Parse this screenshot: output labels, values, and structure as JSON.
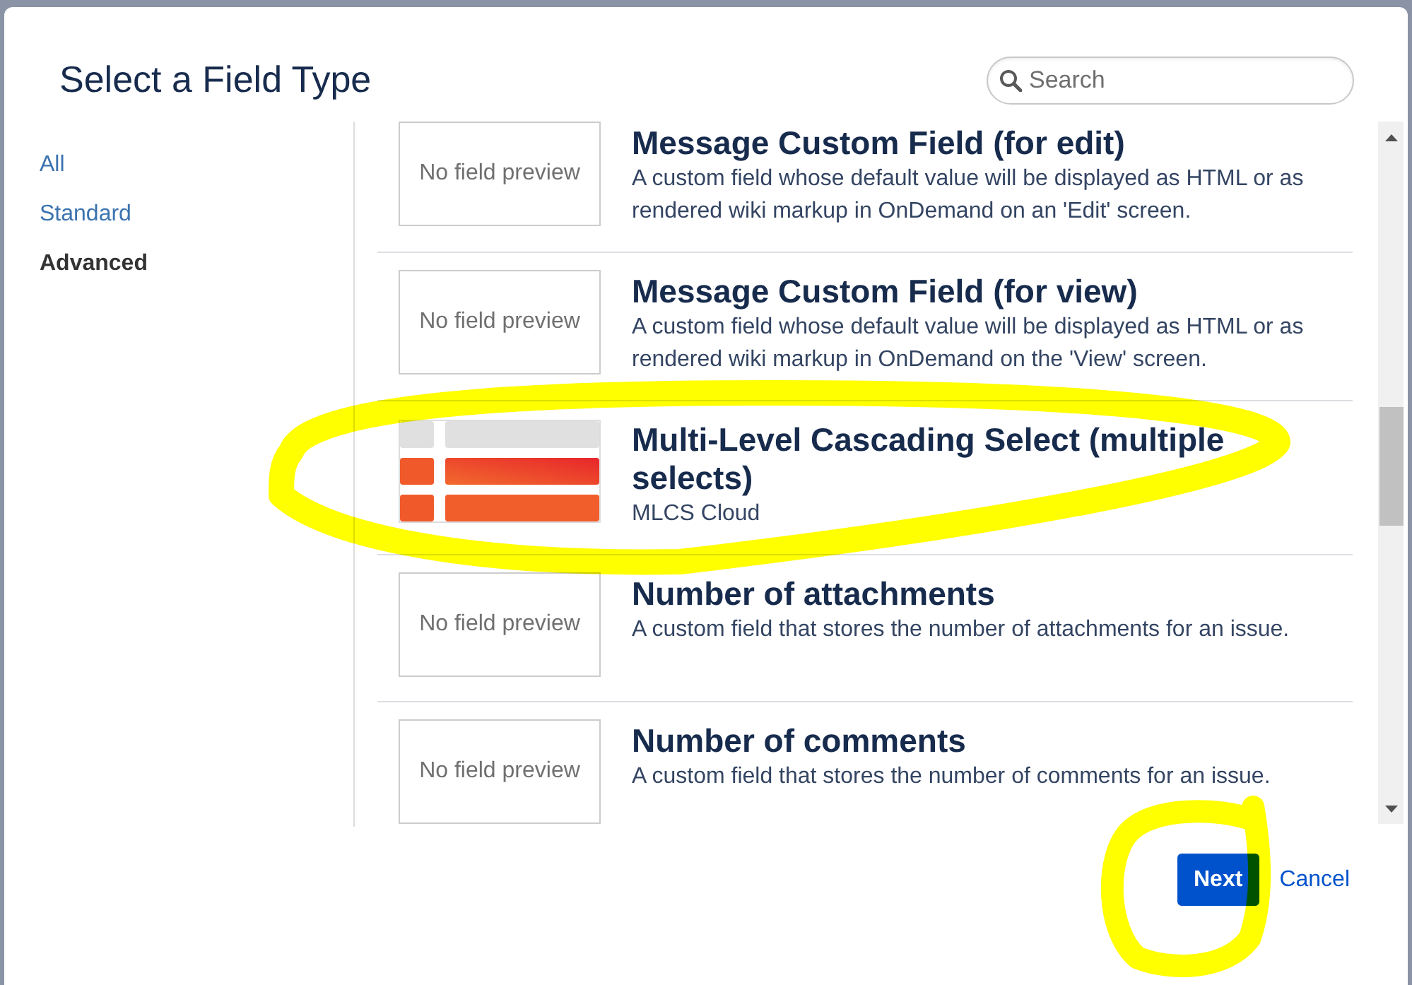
{
  "dialog": {
    "title": "Select a Field Type"
  },
  "search": {
    "placeholder": "Search"
  },
  "sidebar": {
    "items": [
      {
        "label": "All",
        "selected": false
      },
      {
        "label": "Standard",
        "selected": false
      },
      {
        "label": "Advanced",
        "selected": true
      }
    ]
  },
  "fields": [
    {
      "title": "Message Custom Field (for edit)",
      "description": "A custom field whose default value will be displayed as HTML or as rendered wiki markup in OnDemand on an 'Edit' screen.",
      "preview": {
        "kind": "none",
        "text": "No field preview"
      },
      "highlighted": false
    },
    {
      "title": "Message Custom Field (for view)",
      "description": "A custom field whose default value will be displayed as HTML or as rendered wiki markup in OnDemand on the 'View' screen.",
      "preview": {
        "kind": "none",
        "text": "No field preview"
      },
      "highlighted": false
    },
    {
      "title": "Multi-Level Cascading Select (multiple selects)",
      "description": "MLCS Cloud",
      "preview": {
        "kind": "image"
      },
      "highlighted": true
    },
    {
      "title": "Number of attachments",
      "description": "A custom field that stores the number of attachments for an issue.",
      "preview": {
        "kind": "none",
        "text": "No field preview"
      },
      "highlighted": false
    },
    {
      "title": "Number of comments",
      "description": "A custom field that stores the number of comments for an issue.",
      "preview": {
        "kind": "none",
        "text": "No field preview"
      },
      "highlighted": false
    }
  ],
  "buttons": [
    {
      "label": "Next",
      "kind": "primary",
      "highlighted": true
    },
    {
      "label": "Cancel",
      "kind": "link",
      "highlighted": false
    }
  ]
}
